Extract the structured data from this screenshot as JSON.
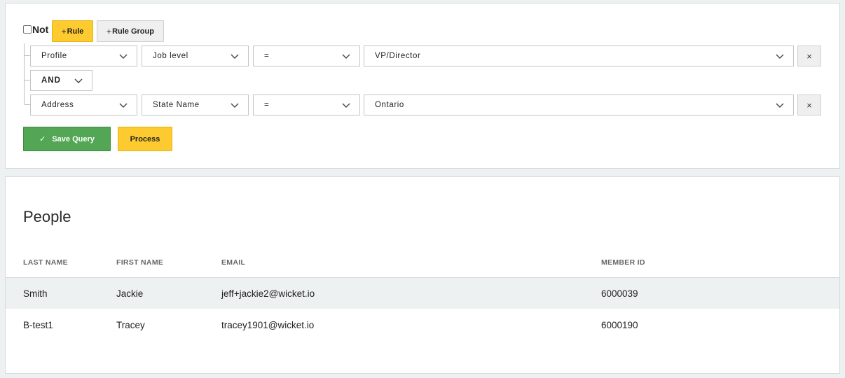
{
  "query_builder": {
    "not_label": "Not",
    "add_rule_label": "Rule",
    "add_group_label": "Rule Group",
    "rules": [
      {
        "field_group": "Profile",
        "field": "Job level",
        "operator": "=",
        "value": "VP/Director",
        "remove_label": "×"
      },
      {
        "field_group": "Address",
        "field": "State Name",
        "operator": "=",
        "value": "Ontario",
        "remove_label": "×"
      }
    ],
    "combinator": "AND",
    "save_label": "Save Query",
    "process_label": "Process"
  },
  "people": {
    "title": "People",
    "columns": [
      "LAST NAME",
      "FIRST NAME",
      "EMAIL",
      "MEMBER ID"
    ],
    "rows": [
      {
        "last_name": "Smith",
        "first_name": "Jackie",
        "email": "jeff+jackie2@wicket.io",
        "member_id": "6000039"
      },
      {
        "last_name": "B-test1",
        "first_name": "Tracey",
        "email": "tracey1901@wicket.io",
        "member_id": "6000190"
      }
    ]
  },
  "colors": {
    "rule_button": "#fdcb2f",
    "save_button": "#53a653",
    "highlight_row": "#eef1f1"
  }
}
